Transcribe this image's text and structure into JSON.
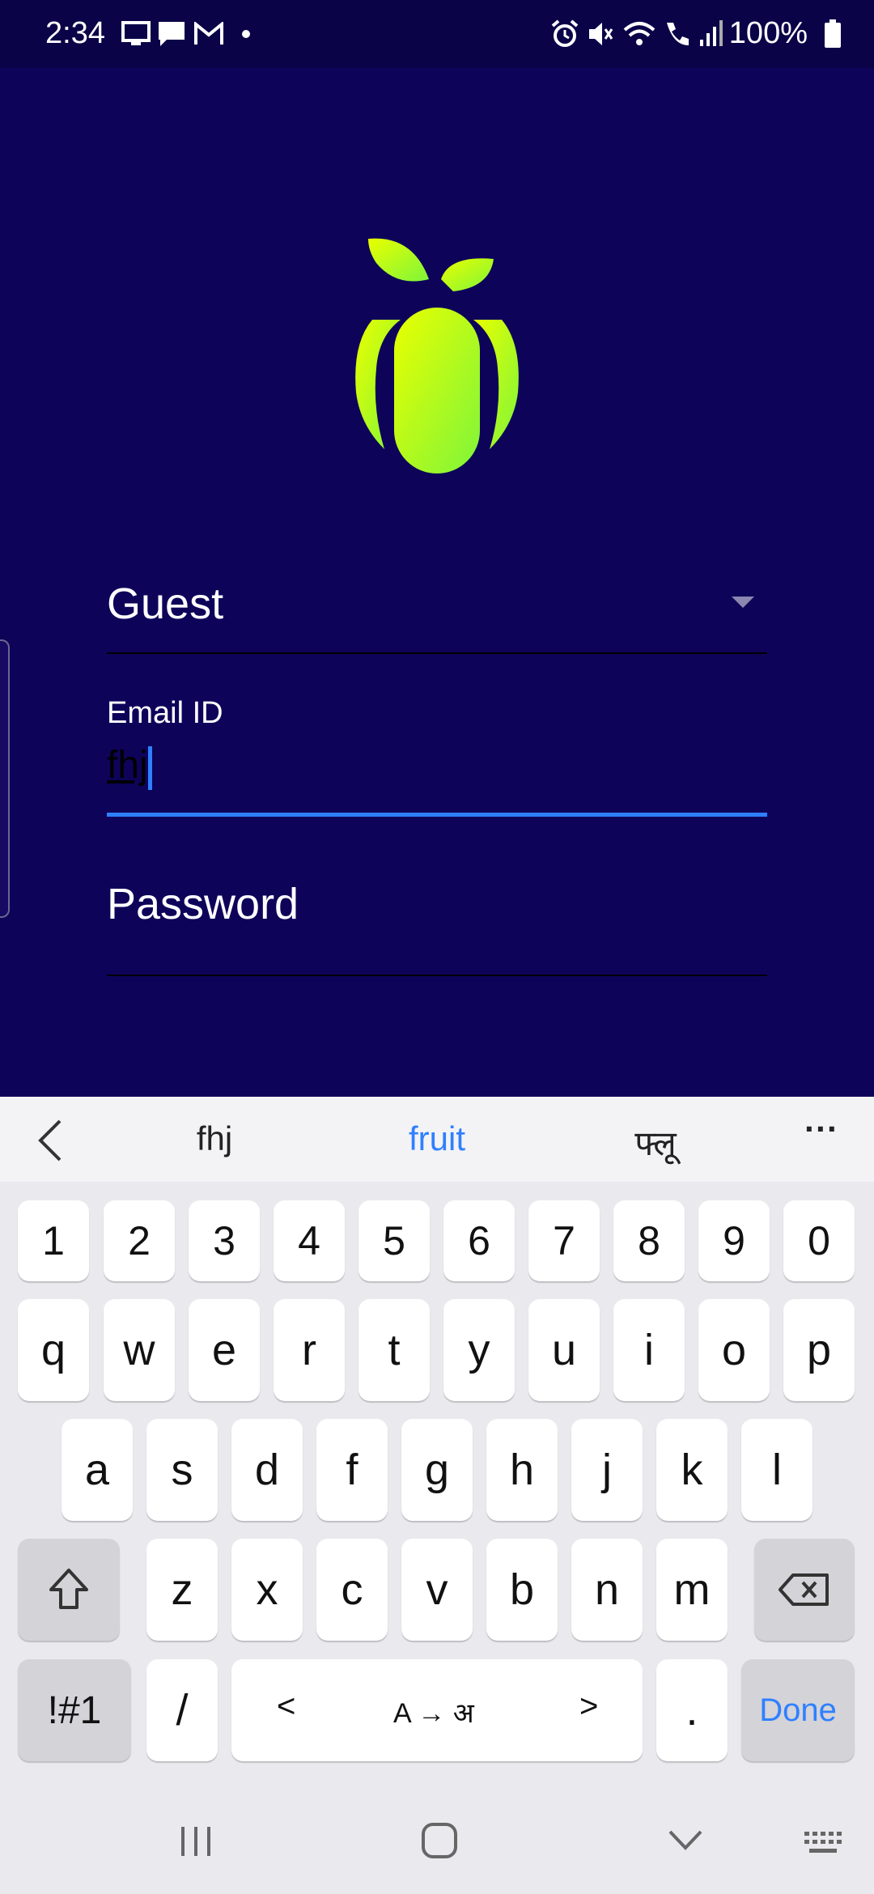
{
  "status_bar": {
    "time": "2:34",
    "battery": "100%",
    "icons": [
      "monitor-icon",
      "chat-icon",
      "gmail-icon",
      "dot-icon",
      "alarm-icon",
      "mute-icon",
      "wifi-icon",
      "call-icon",
      "signal-icon",
      "battery-icon"
    ]
  },
  "form": {
    "role_select": "Guest",
    "email_label": "Email ID",
    "email_value": "fhj",
    "password_label": "Password"
  },
  "keyboard": {
    "suggestions": [
      "fhj",
      "fruit",
      "फ्लू"
    ],
    "more": "···",
    "row_numbers": [
      "1",
      "2",
      "3",
      "4",
      "5",
      "6",
      "7",
      "8",
      "9",
      "0"
    ],
    "row1": [
      "q",
      "w",
      "e",
      "r",
      "t",
      "y",
      "u",
      "i",
      "o",
      "p"
    ],
    "row2": [
      "a",
      "s",
      "d",
      "f",
      "g",
      "h",
      "j",
      "k",
      "l"
    ],
    "row3": [
      "z",
      "x",
      "c",
      "v",
      "b",
      "n",
      "m"
    ],
    "symbols": "!#1",
    "slash": "/",
    "space_left": "<",
    "space_label": "A → अ",
    "space_right": ">",
    "period": ".",
    "done": "Done"
  },
  "colors": {
    "background": "#0d045a",
    "accent": "#2f80ff",
    "logo_green": "#9cf52b"
  }
}
